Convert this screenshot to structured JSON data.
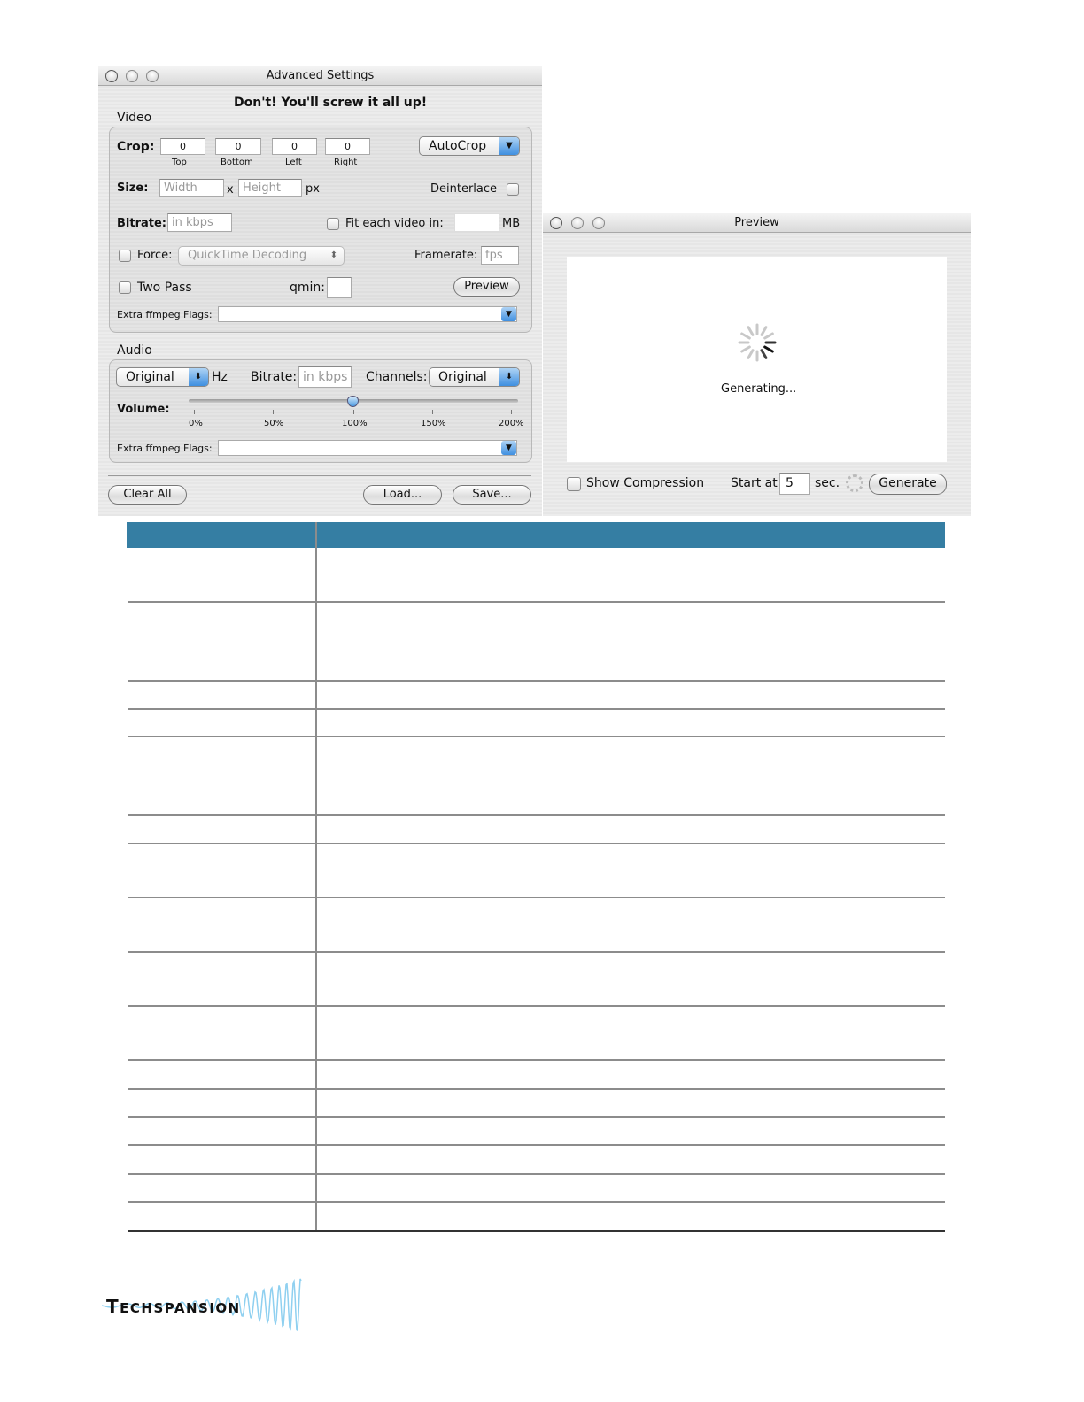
{
  "advanced_window": {
    "title": "Advanced Settings",
    "warning": "Don't! You'll screw it all up!",
    "video": {
      "section_label": "Video",
      "crop_label": "Crop:",
      "crop": [
        {
          "value": "0",
          "label": "Top"
        },
        {
          "value": "0",
          "label": "Bottom"
        },
        {
          "value": "0",
          "label": "Left"
        },
        {
          "value": "0",
          "label": "Right"
        }
      ],
      "autocrop": "AutoCrop",
      "size_label": "Size:",
      "width_placeholder": "Width",
      "x": "x",
      "height_placeholder": "Height",
      "px": "px",
      "deinterlace": "Deinterlace",
      "bitrate_label": "Bitrate:",
      "bitrate_placeholder": "in kbps",
      "fit_label": "Fit each video in:",
      "mb": "MB",
      "force_label": "Force:",
      "force_value": "QuickTime Decoding",
      "framerate_label": "Framerate:",
      "framerate_placeholder": "fps",
      "two_pass": "Two Pass",
      "qmin": "qmin:",
      "preview": "Preview",
      "extra_flags": "Extra ffmpeg Flags:"
    },
    "audio": {
      "section_label": "Audio",
      "hz_value": "Original",
      "hz": "Hz",
      "bitrate_label": "Bitrate:",
      "bitrate_placeholder": "in kbps",
      "channels_label": "Channels:",
      "channels_value": "Original",
      "volume_label": "Volume:",
      "volume_ticks": [
        "0%",
        "50%",
        "100%",
        "150%",
        "200%"
      ],
      "volume_percent": 100,
      "extra_flags": "Extra ffmpeg Flags:"
    },
    "buttons": {
      "clear": "Clear All",
      "load": "Load...",
      "save": "Save..."
    }
  },
  "preview_window": {
    "title": "Preview",
    "status": "Generating...",
    "show_compression": "Show Compression",
    "start_at": "Start at",
    "start_value": "5",
    "sec": "sec.",
    "generate": "Generate"
  },
  "table": {
    "header_color": "#357ea3"
  },
  "footer": {
    "logo": "TECHSPANSION"
  }
}
